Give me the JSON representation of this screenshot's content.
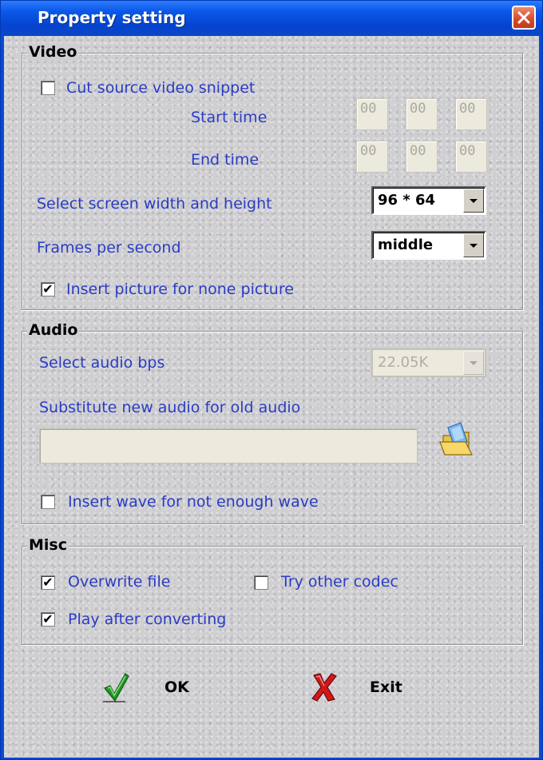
{
  "window": {
    "title": "Property setting"
  },
  "video": {
    "group_title": "Video",
    "cut_snippet": {
      "label": "Cut source video snippet",
      "checked": false
    },
    "start_time": {
      "label": "Start time",
      "hh": "00",
      "mm": "00",
      "ss": "00"
    },
    "end_time": {
      "label": "End time",
      "hh": "00",
      "mm": "00",
      "ss": "00"
    },
    "screen_size": {
      "label": "Select screen width and height",
      "value": "96 * 64"
    },
    "fps": {
      "label": "Frames per second",
      "value": "middle"
    },
    "insert_picture": {
      "label": "Insert picture for none picture",
      "checked": true
    }
  },
  "audio": {
    "group_title": "Audio",
    "bps": {
      "label": "Select audio bps",
      "value": "22.05K",
      "disabled": true
    },
    "substitute": {
      "label": "Substitute new audio for old audio",
      "path": ""
    },
    "insert_wave": {
      "label": "Insert wave for not enough wave",
      "checked": false
    }
  },
  "misc": {
    "group_title": "Misc",
    "overwrite": {
      "label": "Overwrite file",
      "checked": true
    },
    "try_codec": {
      "label": "Try other codec",
      "checked": false
    },
    "play_after": {
      "label": "Play after converting",
      "checked": true
    }
  },
  "actions": {
    "ok_label": "OK",
    "exit_label": "Exit"
  },
  "icons": {
    "close": "close-icon",
    "folder": "open-folder-icon",
    "ok": "green-check-icon",
    "exit": "red-x-icon",
    "dropdown": "chevron-down-icon"
  },
  "colors": {
    "titlebar": "#0a58e8",
    "label_text": "#2b3cc2",
    "client_bg": "#cfcfd2",
    "close_button": "#d44a2a"
  }
}
